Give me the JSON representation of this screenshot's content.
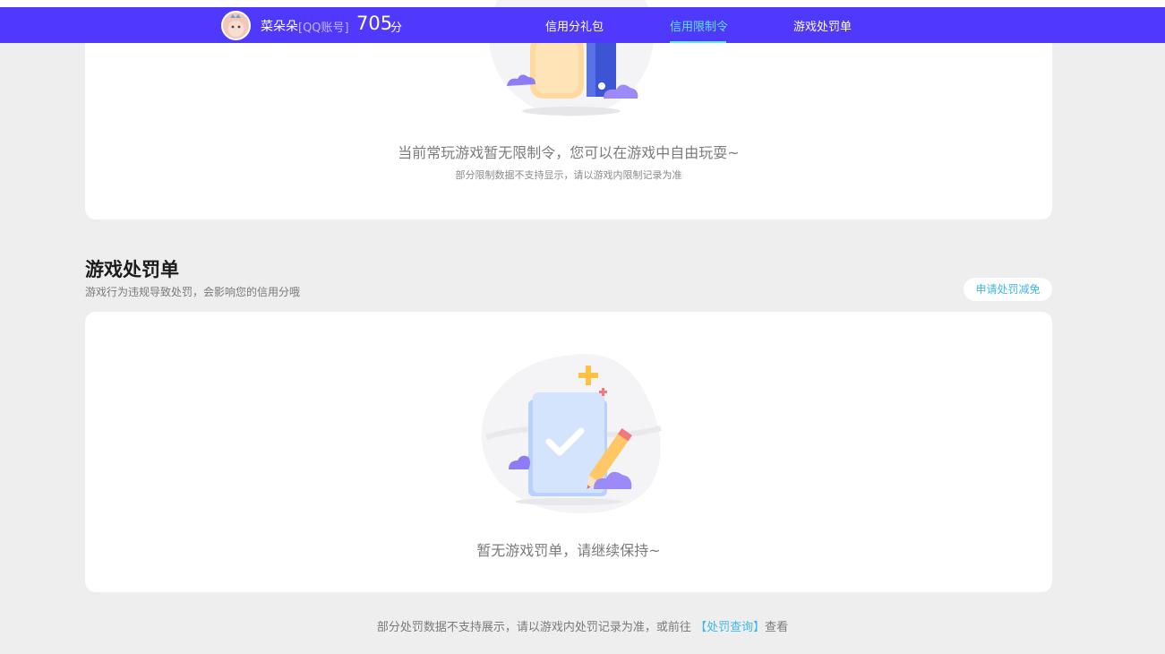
{
  "header": {
    "nickname": "菜朵朵",
    "account_type": "[QQ账号]",
    "score": "705",
    "score_unit": "分",
    "tabs": [
      {
        "label": "信用分礼包",
        "active": false
      },
      {
        "label": "信用限制令",
        "active": true
      },
      {
        "label": "游戏处罚单",
        "active": false
      }
    ]
  },
  "colors": {
    "nav_bg": "#4f39fc",
    "active_tab": "#5fe3ff",
    "link": "#3fb8e6",
    "page_bg": "#eeeeee"
  },
  "restriction": {
    "empty_text": "当前常玩游戏暂无限制令，您可以在游戏中自由玩耍~",
    "note": "部分限制数据不支持显示，请以游戏内限制记录为准"
  },
  "penalty": {
    "title": "游戏处罚单",
    "subtitle": "游戏行为违规导致处罚，会影响您的信用分哦",
    "apply_button": "申请处罚减免",
    "empty_text": "暂无游戏罚单，请继续保持~"
  },
  "footer": {
    "text": "部分处罚数据不支持展示，请以游戏内处罚记录为准，或前往",
    "link": "【处罚查询】",
    "suffix": "查看"
  },
  "icons": [
    "avatar",
    "thumbs-up-illustration",
    "document-check-illustration",
    "cloud-icon",
    "sparkle-icon"
  ]
}
